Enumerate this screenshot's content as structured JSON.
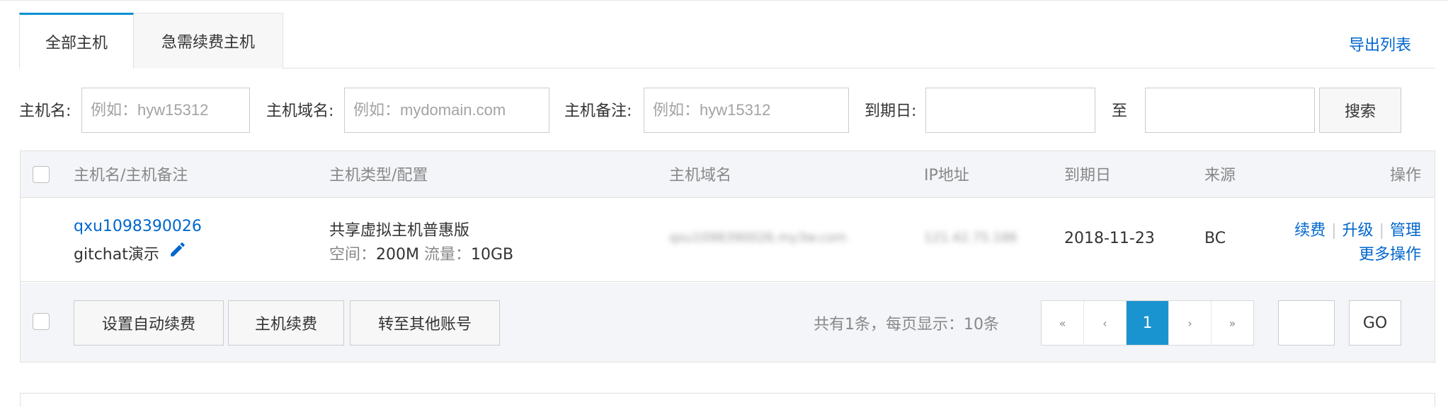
{
  "tabs": {
    "all_hosts": "全部主机",
    "renew_urgent": "急需续费主机"
  },
  "export_link": "导出列表",
  "filters": {
    "host_name_label": "主机名:",
    "host_name_placeholder": "例如：hyw15312",
    "domain_label": "主机域名:",
    "domain_placeholder": "例如：mydomain.com",
    "note_label": "主机备注:",
    "note_placeholder": "例如：hyw15312",
    "expiry_label": "到期日:",
    "expiry_from": "",
    "range_to": "至",
    "expiry_to": "",
    "search_button": "搜索"
  },
  "table": {
    "columns": {
      "name_note": "主机名/主机备注",
      "type_config": "主机类型/配置",
      "domain": "主机域名",
      "ip": "IP地址",
      "expiry": "到期日",
      "source": "来源",
      "actions": "操作"
    },
    "rows": [
      {
        "host_name": "qxu1098390026",
        "host_note": "gitchat演示",
        "type": "共享虚拟主机普惠版",
        "space_label": "空间：",
        "space_value": "200M",
        "traffic_label": "流量：",
        "traffic_value": "10GB",
        "domain": "qxu1098390026.my3w.com",
        "ip": "121.42.75.186",
        "expiry": "2018-11-23",
        "source": "BC",
        "action_renew": "续费",
        "action_upgrade": "升级",
        "action_manage": "管理",
        "action_more": "更多操作"
      }
    ]
  },
  "footer": {
    "auto_renew_button": "设置自动续费",
    "renew_button": "主机续费",
    "transfer_button": "转至其他账号",
    "summary": "共有1条，每页显示：10条",
    "pager": {
      "first": "«",
      "prev": "‹",
      "current": "1",
      "next": "›",
      "last": "»"
    },
    "jump_value": "",
    "go_button": "GO"
  },
  "colors": {
    "accent": "#0b8fcf",
    "link": "#0066cc",
    "pager_active": "#1a94d0",
    "header_bg": "#f3f5f8"
  },
  "icons": {
    "edit_note": "pencil-icon"
  }
}
